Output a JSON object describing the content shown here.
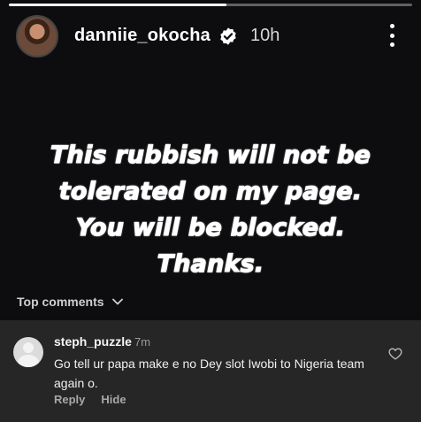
{
  "story": {
    "progress": 0.54,
    "username": "danniie_okocha",
    "verified": true,
    "time": "10h",
    "text_lines": [
      "This rubbish will not be",
      "tolerated on my page.",
      "You will be blocked.",
      "Thanks."
    ],
    "icons": {
      "more": "more-vertical-icon",
      "verified": "verified-badge-icon"
    }
  },
  "comments": {
    "header_label": "Top comments",
    "items": [
      {
        "username": "steph_puzzle",
        "time": "7m",
        "text": "Go tell ur papa make e no Dey slot Iwobi to Nigeria team again o.",
        "reply_label": "Reply",
        "hide_label": "Hide"
      }
    ]
  },
  "colors": {
    "background": "#000000",
    "sheet": "#262626",
    "verified_badge": "#ffffff"
  }
}
